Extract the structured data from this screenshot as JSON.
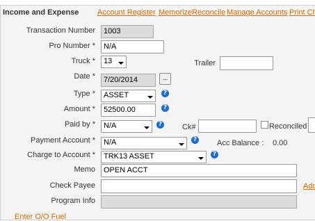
{
  "header": {
    "title": "Income and Expense",
    "links": [
      "Account Register",
      "Memorize",
      "Reconcile",
      "Manage Accounts",
      "Print Ch"
    ]
  },
  "form": {
    "transaction_number": {
      "label": "Transaction Number",
      "value": "1003"
    },
    "pro_number": {
      "label": "Pro Number *",
      "value": "N/A"
    },
    "truck": {
      "label": "Truck *",
      "value": "13"
    },
    "trailer": {
      "label": "Trailer",
      "value": ""
    },
    "date": {
      "label": "Date *",
      "value": "7/20/2014",
      "button": "..."
    },
    "type": {
      "label": "Type *",
      "value": "ASSET"
    },
    "amount": {
      "label": "Amount *",
      "value": "52500.00"
    },
    "paid_by": {
      "label": "Paid by *",
      "value": "N/A"
    },
    "ck_number": {
      "label": "Ck#",
      "value": ""
    },
    "reconciled": {
      "label": "Reconciled",
      "checked": false
    },
    "payment_account": {
      "label": "Payment Account *",
      "value": "N/A"
    },
    "acc_balance": {
      "label": "Acc Balance :",
      "value": "0.00"
    },
    "charge_to_account": {
      "label": "Charge to Account *",
      "value": "TRK13 ASSET"
    },
    "memo": {
      "label": "Memo",
      "value": "OPEN ACCT"
    },
    "check_payee": {
      "label": "Check Payee",
      "value": "",
      "link": "Add"
    },
    "program_info": {
      "label": "Program Info",
      "value": ""
    }
  },
  "footer": {
    "link": "Enter O/O Fuel"
  },
  "help_icon_char": "?"
}
